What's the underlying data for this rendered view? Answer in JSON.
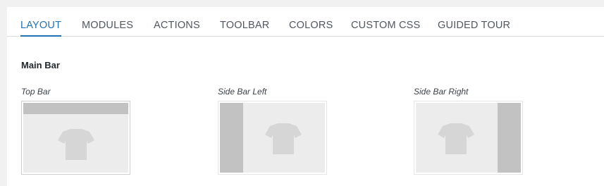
{
  "tabs": [
    {
      "label": "LAYOUT",
      "active": true
    },
    {
      "label": "MODULES",
      "active": false
    },
    {
      "label": "ACTIONS",
      "active": false
    },
    {
      "label": "TOOLBAR",
      "active": false
    },
    {
      "label": "COLORS",
      "active": false
    },
    {
      "label": "CUSTOM CSS",
      "active": false
    },
    {
      "label": "GUIDED TOUR",
      "active": false
    }
  ],
  "section": {
    "title": "Main Bar"
  },
  "layout_options": [
    {
      "label": "Top Bar",
      "icon": "t-shirt-icon",
      "bar": "top",
      "selected": true
    },
    {
      "label": "Side Bar Left",
      "icon": "t-shirt-icon",
      "bar": "left",
      "selected": false
    },
    {
      "label": "Side Bar Right",
      "icon": "t-shirt-icon",
      "bar": "right",
      "selected": false
    }
  ],
  "colors": {
    "accent": "#2271b1",
    "bar": "#c2c2c2",
    "preview_bg": "#ececec",
    "shirt": "#d6d6d6"
  }
}
